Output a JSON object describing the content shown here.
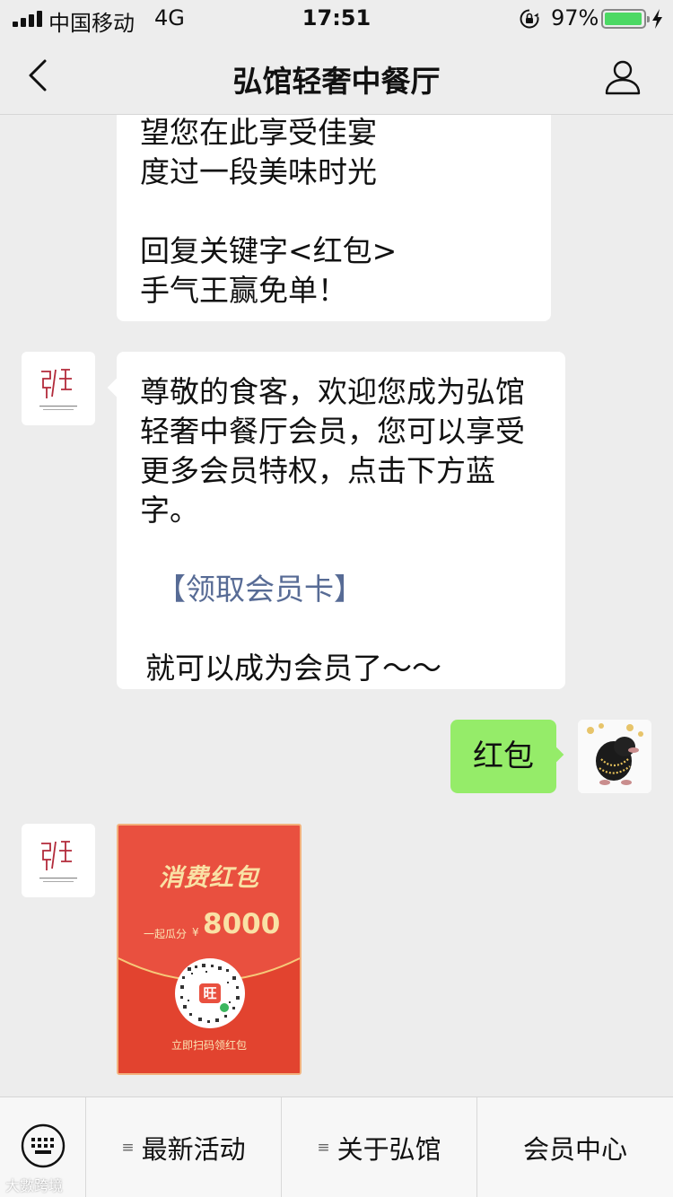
{
  "status_bar": {
    "carrier": "中国移动",
    "network": "4G",
    "time": "17:51",
    "battery_percent": "97%",
    "battery_level": 0.97
  },
  "nav": {
    "title": "弘馆轻奢中餐厅",
    "back_icon": "chevron-left",
    "profile_icon": "person-outline"
  },
  "messages": {
    "m1": {
      "lines": [
        "望您在此享受佳宴",
        "度过一段美味时光",
        "",
        "回复关键字<红包>",
        "手气王赢免单！"
      ]
    },
    "m2": {
      "lines": [
        "尊敬的食客，欢迎您成为弘馆",
        "轻奢中餐厅会员，您可以享受",
        "更多会员特权，点击下方蓝",
        "字。"
      ],
      "link": "【领取会员卡】",
      "closing": "就可以成为会员了～～"
    },
    "m3": {
      "text": "红包"
    },
    "m4": {
      "title": "消费红包",
      "caption": "一起瓜分",
      "currency": "¥",
      "amount": "8000",
      "badge": "旺",
      "footer": "立即扫码领红包"
    }
  },
  "bottom_menu": {
    "keyboard_icon": "keyboard",
    "items": [
      {
        "label": "最新活动",
        "icon": "≡"
      },
      {
        "label": "关于弘馆",
        "icon": "≡"
      },
      {
        "label": "会员中心",
        "icon": ""
      }
    ]
  },
  "watermark": "大數跨境",
  "colors": {
    "background": "#ededed",
    "bubble_white": "#ffffff",
    "bubble_green": "#95ec69",
    "link_blue": "#576b95",
    "packet_red": "#e9503f",
    "packet_gold": "#f9e1a5",
    "battery_green": "#4cd964"
  }
}
